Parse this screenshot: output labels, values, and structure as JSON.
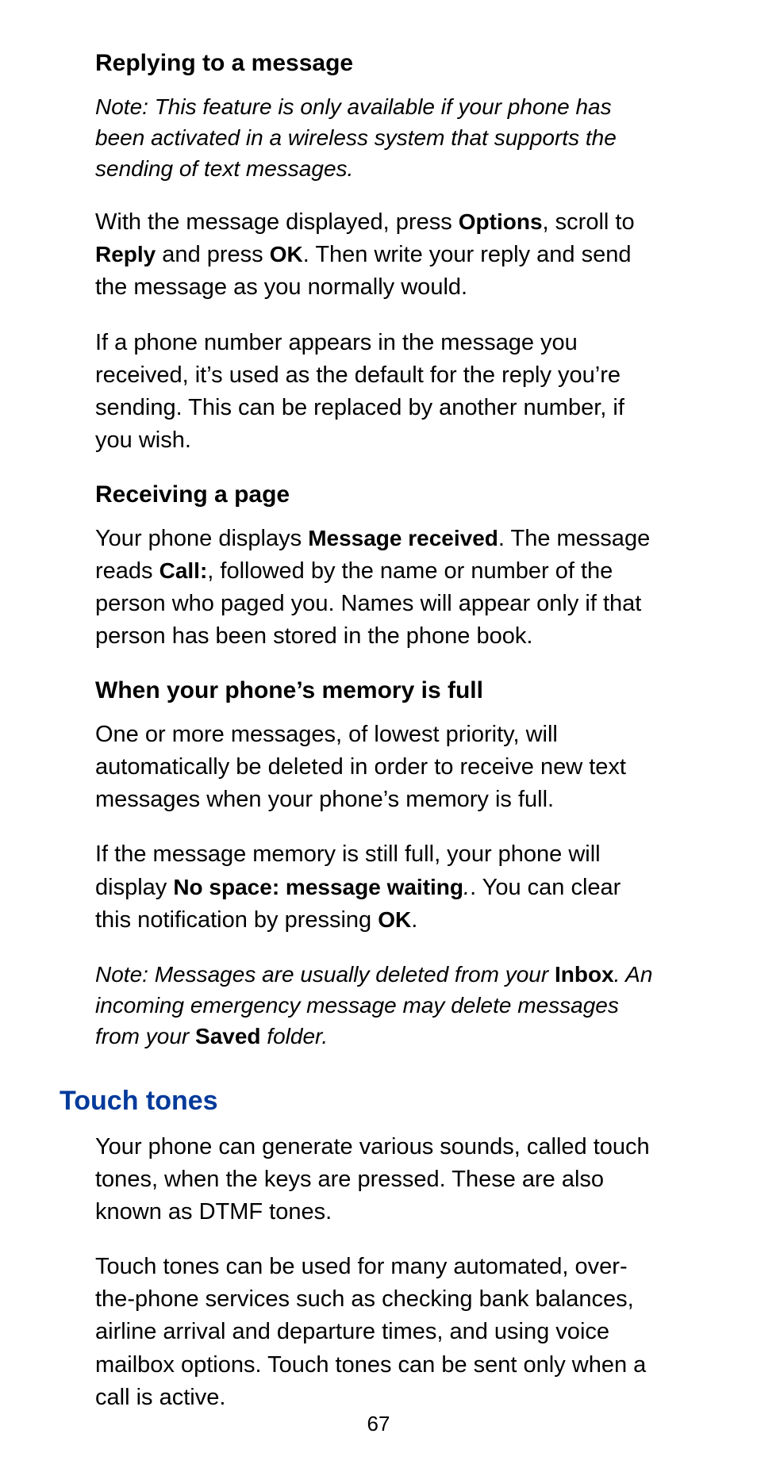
{
  "page_number": "67",
  "sections": {
    "replying": {
      "heading": "Replying to a message",
      "note_full": "Note:  This feature is only available if your phone has been activated in a wireless system that supports the sending of text messages.",
      "p1_a": "With the message displayed, press ",
      "p1_b": "Options",
      "p1_c": ", scroll to ",
      "p1_d": "Reply",
      "p1_e": " and press ",
      "p1_f": "OK",
      "p1_g": ". Then write your reply and send the message as you normally would.",
      "p2": "If a phone number appears in the message you received, it’s used as the default for the reply you’re sending. This can be replaced by another number, if you wish."
    },
    "receiving": {
      "heading": "Receiving a page",
      "p1_a": "Your phone displays ",
      "p1_b": "Message received",
      "p1_c": ". The message reads ",
      "p1_d": "Call:",
      "p1_e": ", followed by the name or number of the person who paged you. Names will appear only if that person has been stored in the phone book."
    },
    "memory": {
      "heading": "When your phone’s memory is full",
      "p1": "One or more messages, of lowest priority, will automatically be deleted in order to receive new text messages when your phone’s memory is full.",
      "p2_a": "If the message memory is still full, your phone will display ",
      "p2_b": "No space: message waiting",
      "p2_c": ". You can clear this notification by pressing ",
      "p2_d": "OK",
      "p2_dot": ".",
      "note_a": "Note: Messages are usually deleted from your ",
      "note_b": "Inbox",
      "note_c": ". An incoming emergency message may delete messages from your ",
      "note_d": "Saved",
      "note_e": " folder."
    },
    "touch": {
      "title": "Touch tones",
      "p1": "Your phone can generate various sounds, called touch tones, when the keys are pressed. These are also known as DTMF tones.",
      "p2": "Touch tones can be used for many automated, over-the-phone services such as checking bank balances, airline arrival and departure times, and using voice mailbox options. Touch tones can be sent only when a call is active."
    }
  }
}
